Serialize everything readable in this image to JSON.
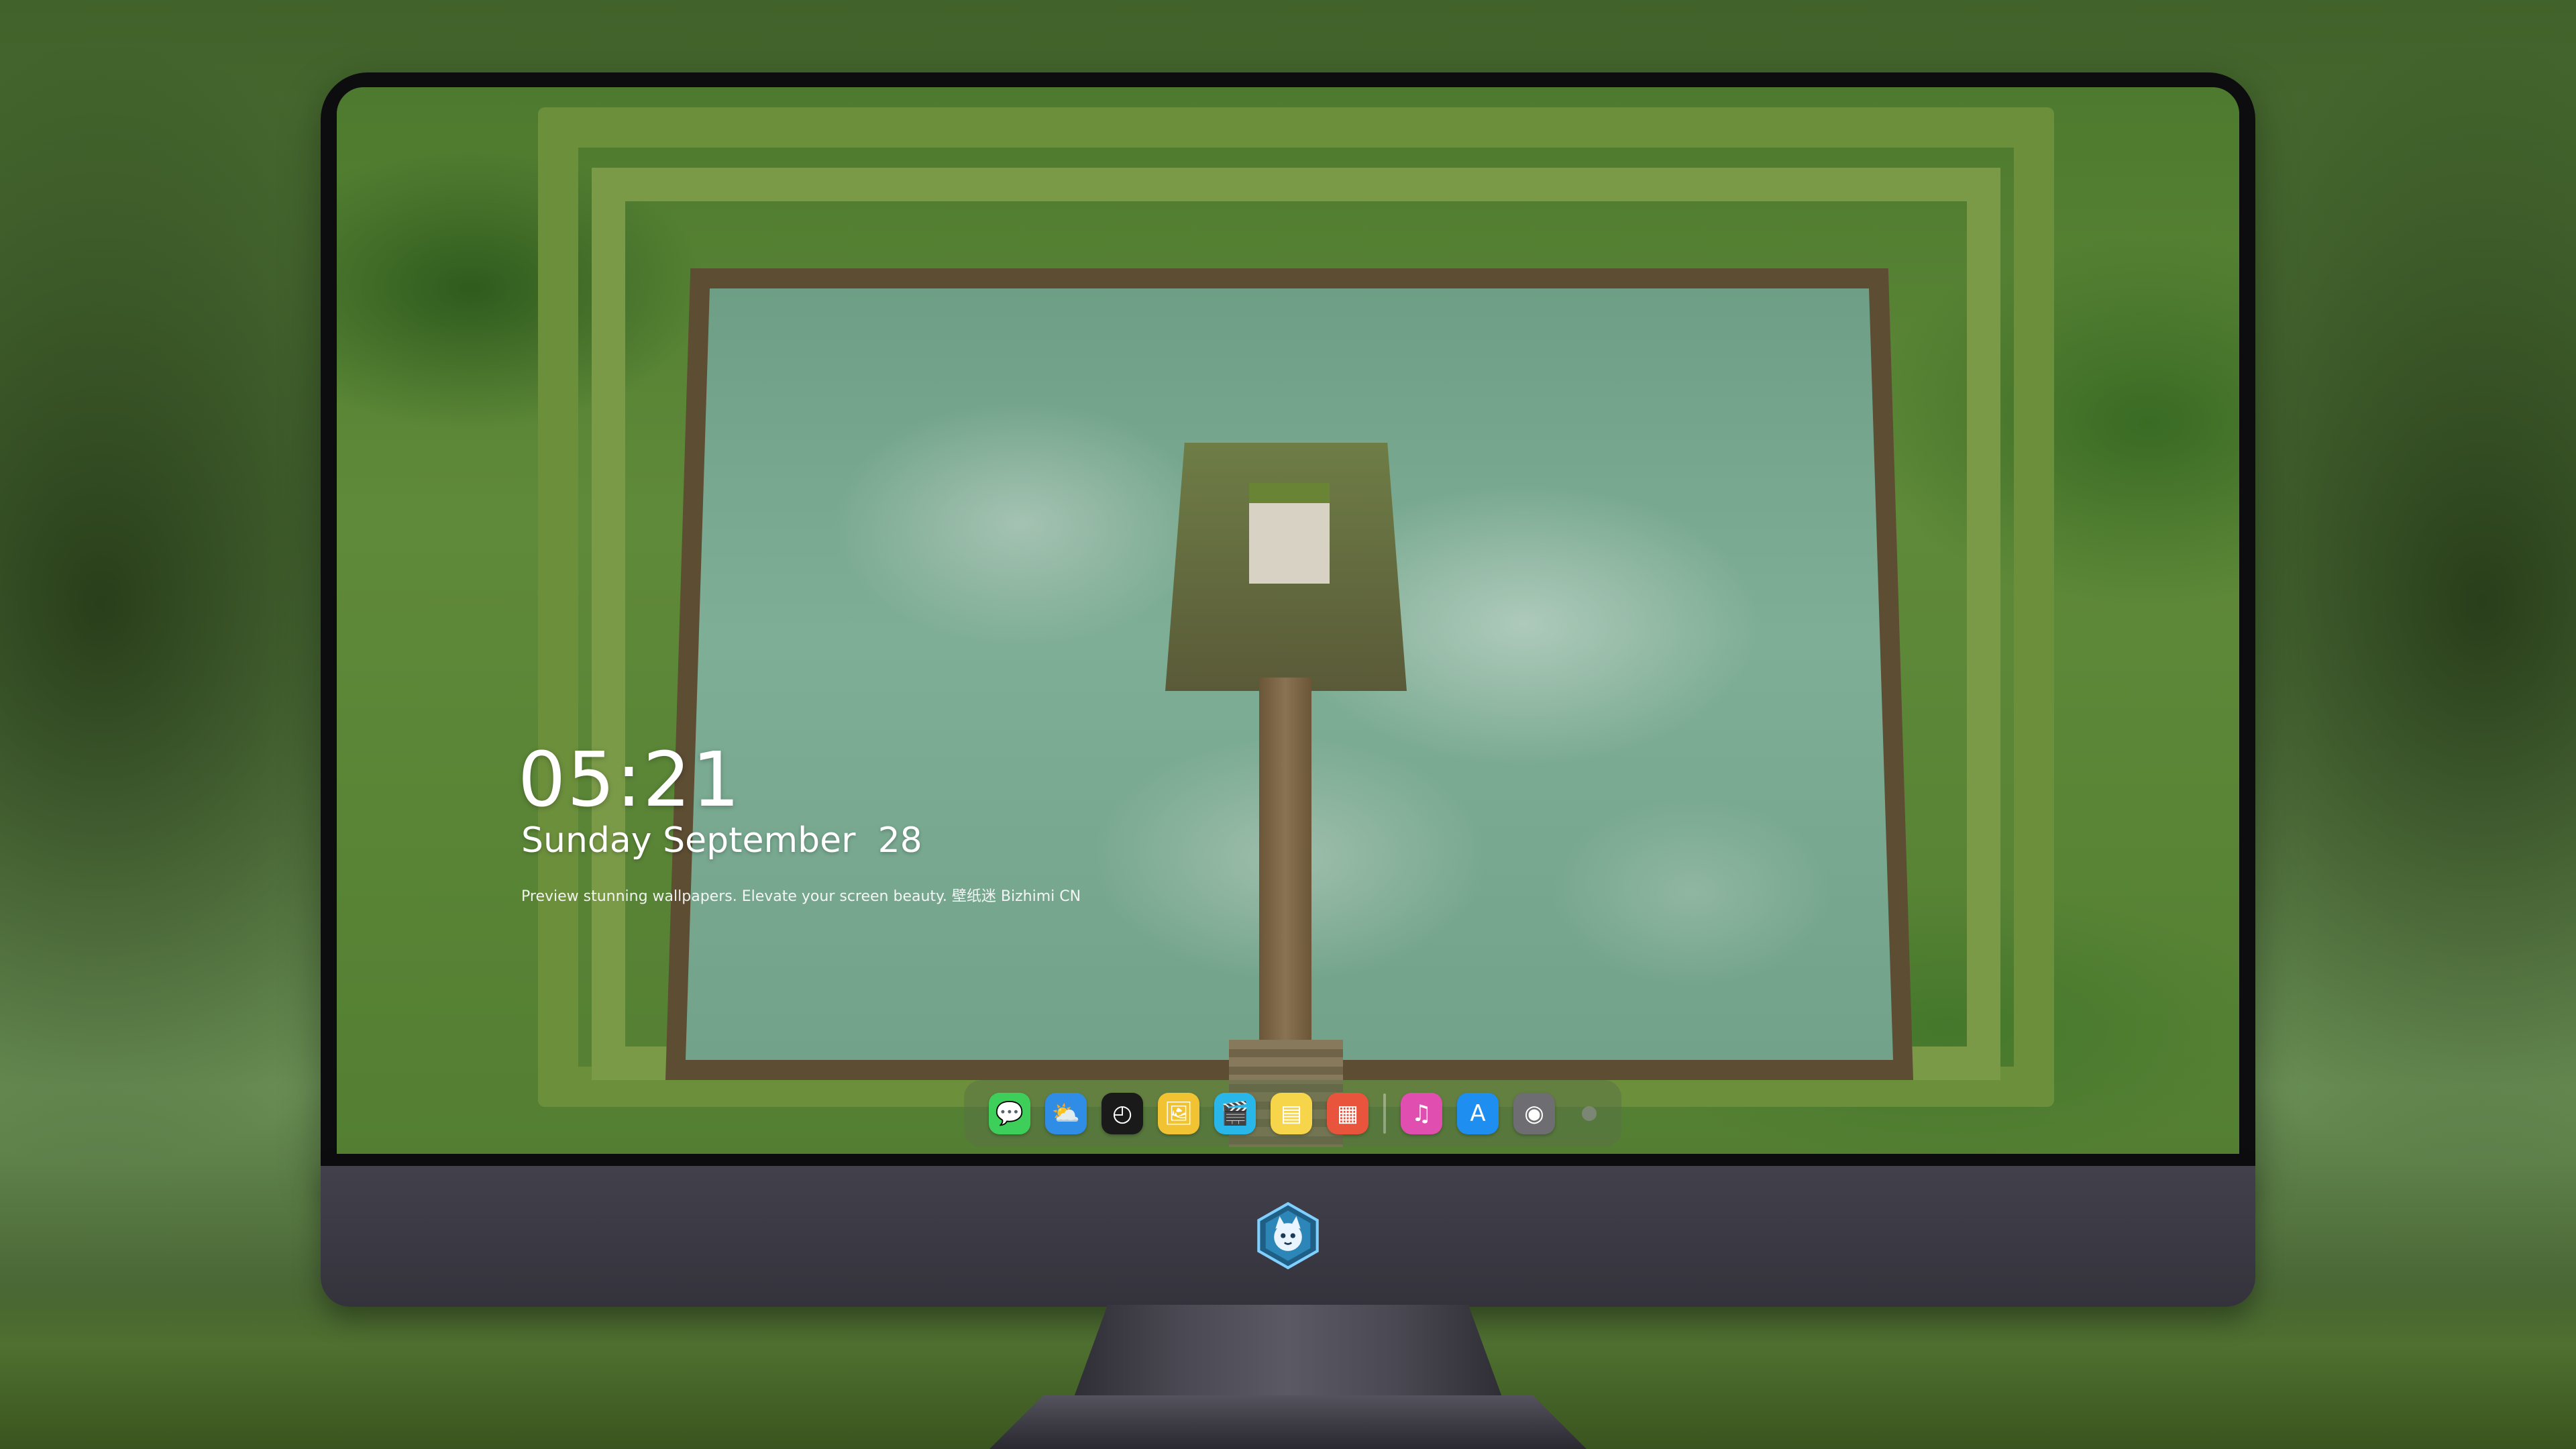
{
  "lockscreen": {
    "time": "05:21",
    "date": "Sunday September  28",
    "tagline": "Preview stunning wallpapers. Elevate your screen beauty. 壁纸迷    Bizhimi CN"
  },
  "dock": {
    "apps": [
      {
        "name": "Messages",
        "glyph": "💬",
        "color": "#3ecf5b"
      },
      {
        "name": "Weather",
        "glyph": "⛅",
        "color": "#2f8de6"
      },
      {
        "name": "Clock",
        "glyph": "◴",
        "color": "#1a1a1a"
      },
      {
        "name": "Preview",
        "glyph": "🖼",
        "color": "#f1c232"
      },
      {
        "name": "Clips",
        "glyph": "🎬",
        "color": "#29b6e8"
      },
      {
        "name": "Notes",
        "glyph": "▤",
        "color": "#f7d54a"
      },
      {
        "name": "Photo Booth",
        "glyph": "▦",
        "color": "#e8553c"
      },
      {
        "name": "Music",
        "glyph": "♫",
        "color": "#e04fb0"
      },
      {
        "name": "App Store",
        "glyph": "A",
        "color": "#1e8ef0"
      },
      {
        "name": "Camera",
        "glyph": "◉",
        "color": "#6d6d72"
      }
    ]
  },
  "monitor": {
    "logo_icon": "cat-mascot-shield-icon",
    "accent": "#3f9ac8"
  }
}
